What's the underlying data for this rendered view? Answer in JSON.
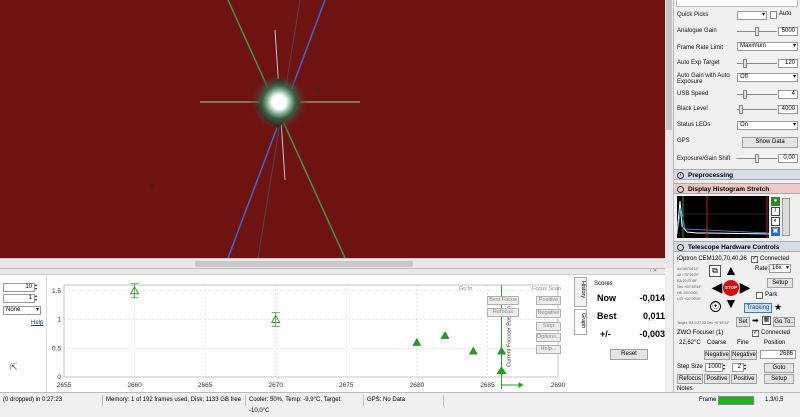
{
  "camera": {
    "quick_picks_label": "Quick Picks",
    "auto_label": "Auto",
    "analogue_gain_label": "Analogue Gain",
    "analogue_gain_value": "5000",
    "frame_rate_label": "Frame Rate Limit",
    "frame_rate_value": "Maximum",
    "auto_exp_label": "Auto Exp Target",
    "auto_exp_value": "120",
    "auto_gain_label": "Auto Gain with Auto Exposure",
    "auto_gain_value": "Off",
    "usb_speed_label": "USB Speed",
    "usb_speed_value": "4",
    "black_level_label": "Black Level",
    "black_level_value": "4000",
    "status_leds_label": "Status LEDs",
    "status_leds_value": "On",
    "gps_label": "GPS",
    "show_data_button": "Show Data",
    "exposure_shift_label": "Exposure/Gain Shift",
    "exposure_shift_value": "0,00"
  },
  "sections": {
    "preprocessing": "Preprocessing",
    "histogram": "Display Histogram Stretch",
    "telescope": "Telescope Hardware Controls"
  },
  "telescope": {
    "mount_name": "iOptron CEM120,70,40,26",
    "connected_label": "Connected",
    "rate_label": "Rate:",
    "rate_value": "16x",
    "stop_label": "STOP",
    "setup_button": "Setup",
    "park_label": "Park",
    "tracking_button": "Tracking",
    "set_button": "Set",
    "goto_button": "Go To..",
    "small_text": "Target: RA 0:27:23 Dec +0°48'34\"",
    "readout_lines": [
      "Az   280°06'10\"",
      "Alt  +75°20'29\"",
      "RA   20:37'45\"",
      "Dec  +00°48'34\"",
      "HA   -00:00:00",
      "LST  +00°00'00\""
    ]
  },
  "focuser": {
    "name": "ZWO Focuser (1)",
    "connected_label": "Connected",
    "temp": "22,62°C",
    "coarse_label": "Coarse",
    "fine_label": "Fine",
    "position_label": "Position",
    "negative1": "Negative",
    "negative2": "Negative",
    "position_value": "2686",
    "step_size_label": "Step Size",
    "step_size_value": "1000",
    "fine_value": "2",
    "goto_button": "Goto",
    "refocus_button": "Refocus",
    "positive1": "Positive",
    "positive2": "Positive",
    "setup_button": "Setup",
    "notes_label": "Notes"
  },
  "focus_panel": {
    "field1": "10",
    "field2": "1",
    "select_value": "None",
    "help_link": "Help",
    "goto_label": "Go to",
    "goto_btn1": "Best Focus",
    "goto_btn2": "Refocus",
    "focus_scan_label": "Focus Scan",
    "positive_btn": "Positive",
    "negative_btn": "Negative",
    "stop_btn": "Stop",
    "options_btn": "Options...",
    "help_btn": "Help...",
    "tab_history": "History",
    "tab_graph": "Graph",
    "current_focuser_label": "Current Focuser Position",
    "scores_label": "Scores",
    "now_label": "Now",
    "now_value": "-0,014",
    "best_label": "Best",
    "best_value": "0,011",
    "pm_label": "+/-",
    "pm_value": "-0,003",
    "reset_button": "Reset",
    "panel_tag": "‹ ✕"
  },
  "status_bar": {
    "frames": "(0 dropped) in 0:27:23",
    "memory": "Memory: 1 of 192 frames used, Disk: 1133 GB free",
    "cooler": "Cooler: 50%, Temp: -9,9°C, Target: -10,0°C",
    "gps": "GPS: No Data",
    "frame_label": "Frame",
    "frame_progress": 1.0,
    "fps": "1,3/0,5"
  },
  "chart_data": {
    "type": "scatter",
    "title": "",
    "xlabel": "",
    "ylabel": "",
    "xlim": [
      2655,
      2690
    ],
    "ylim": [
      0,
      1.6
    ],
    "x_ticks": [
      "2655",
      "2660",
      "2665",
      "2670",
      "2675",
      "2680",
      "2685",
      "2690"
    ],
    "y_ticks": [
      "0",
      "0.5",
      "1",
      "1.5"
    ],
    "series": [
      {
        "marker": "triangle-open",
        "points": [
          {
            "x": 2660,
            "y": 1.5
          },
          {
            "x": 2670,
            "y": 1.0
          }
        ]
      },
      {
        "marker": "triangle-filled",
        "points": [
          {
            "x": 2680,
            "y": 0.6
          },
          {
            "x": 2682,
            "y": 0.72
          },
          {
            "x": 2684,
            "y": 0.45
          },
          {
            "x": 2686,
            "y": 0.45
          }
        ]
      }
    ],
    "current_position": 2686,
    "colors": {
      "points": "#2a9a2a",
      "current": "#1aa31a"
    }
  }
}
